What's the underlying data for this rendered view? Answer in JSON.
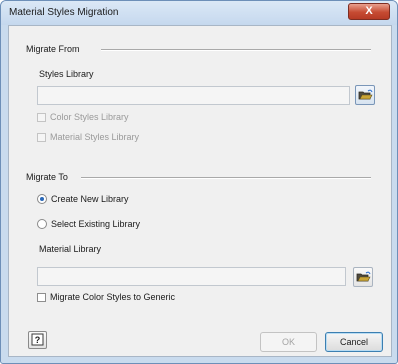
{
  "window": {
    "title": "Material Styles Migration",
    "close_label": "X"
  },
  "migrate_from": {
    "heading": "Migrate From",
    "styles_library_label": "Styles Library",
    "styles_library_value": "",
    "color_styles_label": "Color Styles Library",
    "material_styles_label": "Material Styles Library"
  },
  "migrate_to": {
    "heading": "Migrate To",
    "create_new_label": "Create New Library",
    "select_existing_label": "Select Existing Library",
    "material_library_label": "Material Library",
    "material_library_value": "",
    "migrate_color_label": "Migrate Color Styles to Generic"
  },
  "footer": {
    "help_label": "?",
    "ok_label": "OK",
    "cancel_label": "Cancel"
  }
}
